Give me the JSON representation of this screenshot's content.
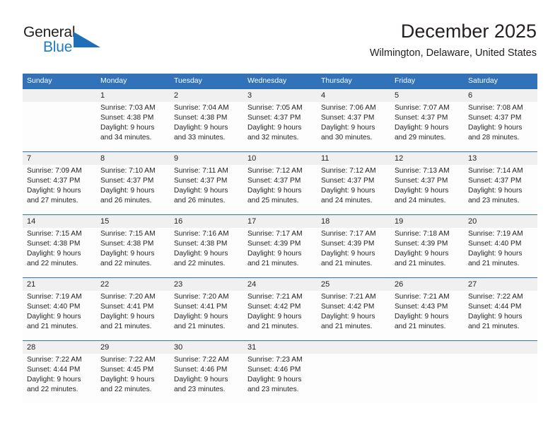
{
  "logo": {
    "word_one": "General",
    "word_two": "Blue",
    "triangle_color": "#1f6fb8",
    "blue_text_color": "#1f7bc1",
    "icon": "general-blue-logo"
  },
  "header": {
    "title": "December 2025",
    "location": "Wilmington, Delaware, United States"
  },
  "theme": {
    "header_bar": "#3172b9",
    "row_stripe": "#f0f0f0",
    "cell_background": "#fdfdfd",
    "text": "#231f20",
    "divider": "#3172b9"
  },
  "weekdays": [
    "Sunday",
    "Monday",
    "Tuesday",
    "Wednesday",
    "Thursday",
    "Friday",
    "Saturday"
  ],
  "weeks": [
    {
      "daynums": [
        "",
        "1",
        "2",
        "3",
        "4",
        "5",
        "6"
      ],
      "cells": [
        {
          "empty": true,
          "sunrise": "",
          "sunset": "",
          "daylight_line1": "",
          "daylight_line2": ""
        },
        {
          "empty": false,
          "sunrise": "Sunrise: 7:03 AM",
          "sunset": "Sunset: 4:38 PM",
          "daylight_line1": "Daylight: 9 hours",
          "daylight_line2": "and 34 minutes."
        },
        {
          "empty": false,
          "sunrise": "Sunrise: 7:04 AM",
          "sunset": "Sunset: 4:38 PM",
          "daylight_line1": "Daylight: 9 hours",
          "daylight_line2": "and 33 minutes."
        },
        {
          "empty": false,
          "sunrise": "Sunrise: 7:05 AM",
          "sunset": "Sunset: 4:37 PM",
          "daylight_line1": "Daylight: 9 hours",
          "daylight_line2": "and 32 minutes."
        },
        {
          "empty": false,
          "sunrise": "Sunrise: 7:06 AM",
          "sunset": "Sunset: 4:37 PM",
          "daylight_line1": "Daylight: 9 hours",
          "daylight_line2": "and 30 minutes."
        },
        {
          "empty": false,
          "sunrise": "Sunrise: 7:07 AM",
          "sunset": "Sunset: 4:37 PM",
          "daylight_line1": "Daylight: 9 hours",
          "daylight_line2": "and 29 minutes."
        },
        {
          "empty": false,
          "sunrise": "Sunrise: 7:08 AM",
          "sunset": "Sunset: 4:37 PM",
          "daylight_line1": "Daylight: 9 hours",
          "daylight_line2": "and 28 minutes."
        }
      ]
    },
    {
      "daynums": [
        "7",
        "8",
        "9",
        "10",
        "11",
        "12",
        "13"
      ],
      "cells": [
        {
          "empty": false,
          "sunrise": "Sunrise: 7:09 AM",
          "sunset": "Sunset: 4:37 PM",
          "daylight_line1": "Daylight: 9 hours",
          "daylight_line2": "and 27 minutes."
        },
        {
          "empty": false,
          "sunrise": "Sunrise: 7:10 AM",
          "sunset": "Sunset: 4:37 PM",
          "daylight_line1": "Daylight: 9 hours",
          "daylight_line2": "and 26 minutes."
        },
        {
          "empty": false,
          "sunrise": "Sunrise: 7:11 AM",
          "sunset": "Sunset: 4:37 PM",
          "daylight_line1": "Daylight: 9 hours",
          "daylight_line2": "and 26 minutes."
        },
        {
          "empty": false,
          "sunrise": "Sunrise: 7:12 AM",
          "sunset": "Sunset: 4:37 PM",
          "daylight_line1": "Daylight: 9 hours",
          "daylight_line2": "and 25 minutes."
        },
        {
          "empty": false,
          "sunrise": "Sunrise: 7:12 AM",
          "sunset": "Sunset: 4:37 PM",
          "daylight_line1": "Daylight: 9 hours",
          "daylight_line2": "and 24 minutes."
        },
        {
          "empty": false,
          "sunrise": "Sunrise: 7:13 AM",
          "sunset": "Sunset: 4:37 PM",
          "daylight_line1": "Daylight: 9 hours",
          "daylight_line2": "and 24 minutes."
        },
        {
          "empty": false,
          "sunrise": "Sunrise: 7:14 AM",
          "sunset": "Sunset: 4:37 PM",
          "daylight_line1": "Daylight: 9 hours",
          "daylight_line2": "and 23 minutes."
        }
      ]
    },
    {
      "daynums": [
        "14",
        "15",
        "16",
        "17",
        "18",
        "19",
        "20"
      ],
      "cells": [
        {
          "empty": false,
          "sunrise": "Sunrise: 7:15 AM",
          "sunset": "Sunset: 4:38 PM",
          "daylight_line1": "Daylight: 9 hours",
          "daylight_line2": "and 22 minutes."
        },
        {
          "empty": false,
          "sunrise": "Sunrise: 7:15 AM",
          "sunset": "Sunset: 4:38 PM",
          "daylight_line1": "Daylight: 9 hours",
          "daylight_line2": "and 22 minutes."
        },
        {
          "empty": false,
          "sunrise": "Sunrise: 7:16 AM",
          "sunset": "Sunset: 4:38 PM",
          "daylight_line1": "Daylight: 9 hours",
          "daylight_line2": "and 22 minutes."
        },
        {
          "empty": false,
          "sunrise": "Sunrise: 7:17 AM",
          "sunset": "Sunset: 4:39 PM",
          "daylight_line1": "Daylight: 9 hours",
          "daylight_line2": "and 21 minutes."
        },
        {
          "empty": false,
          "sunrise": "Sunrise: 7:17 AM",
          "sunset": "Sunset: 4:39 PM",
          "daylight_line1": "Daylight: 9 hours",
          "daylight_line2": "and 21 minutes."
        },
        {
          "empty": false,
          "sunrise": "Sunrise: 7:18 AM",
          "sunset": "Sunset: 4:39 PM",
          "daylight_line1": "Daylight: 9 hours",
          "daylight_line2": "and 21 minutes."
        },
        {
          "empty": false,
          "sunrise": "Sunrise: 7:19 AM",
          "sunset": "Sunset: 4:40 PM",
          "daylight_line1": "Daylight: 9 hours",
          "daylight_line2": "and 21 minutes."
        }
      ]
    },
    {
      "daynums": [
        "21",
        "22",
        "23",
        "24",
        "25",
        "26",
        "27"
      ],
      "cells": [
        {
          "empty": false,
          "sunrise": "Sunrise: 7:19 AM",
          "sunset": "Sunset: 4:40 PM",
          "daylight_line1": "Daylight: 9 hours",
          "daylight_line2": "and 21 minutes."
        },
        {
          "empty": false,
          "sunrise": "Sunrise: 7:20 AM",
          "sunset": "Sunset: 4:41 PM",
          "daylight_line1": "Daylight: 9 hours",
          "daylight_line2": "and 21 minutes."
        },
        {
          "empty": false,
          "sunrise": "Sunrise: 7:20 AM",
          "sunset": "Sunset: 4:41 PM",
          "daylight_line1": "Daylight: 9 hours",
          "daylight_line2": "and 21 minutes."
        },
        {
          "empty": false,
          "sunrise": "Sunrise: 7:21 AM",
          "sunset": "Sunset: 4:42 PM",
          "daylight_line1": "Daylight: 9 hours",
          "daylight_line2": "and 21 minutes."
        },
        {
          "empty": false,
          "sunrise": "Sunrise: 7:21 AM",
          "sunset": "Sunset: 4:42 PM",
          "daylight_line1": "Daylight: 9 hours",
          "daylight_line2": "and 21 minutes."
        },
        {
          "empty": false,
          "sunrise": "Sunrise: 7:21 AM",
          "sunset": "Sunset: 4:43 PM",
          "daylight_line1": "Daylight: 9 hours",
          "daylight_line2": "and 21 minutes."
        },
        {
          "empty": false,
          "sunrise": "Sunrise: 7:22 AM",
          "sunset": "Sunset: 4:44 PM",
          "daylight_line1": "Daylight: 9 hours",
          "daylight_line2": "and 21 minutes."
        }
      ]
    },
    {
      "daynums": [
        "28",
        "29",
        "30",
        "31",
        "",
        "",
        ""
      ],
      "cells": [
        {
          "empty": false,
          "sunrise": "Sunrise: 7:22 AM",
          "sunset": "Sunset: 4:44 PM",
          "daylight_line1": "Daylight: 9 hours",
          "daylight_line2": "and 22 minutes."
        },
        {
          "empty": false,
          "sunrise": "Sunrise: 7:22 AM",
          "sunset": "Sunset: 4:45 PM",
          "daylight_line1": "Daylight: 9 hours",
          "daylight_line2": "and 22 minutes."
        },
        {
          "empty": false,
          "sunrise": "Sunrise: 7:22 AM",
          "sunset": "Sunset: 4:46 PM",
          "daylight_line1": "Daylight: 9 hours",
          "daylight_line2": "and 23 minutes."
        },
        {
          "empty": false,
          "sunrise": "Sunrise: 7:23 AM",
          "sunset": "Sunset: 4:46 PM",
          "daylight_line1": "Daylight: 9 hours",
          "daylight_line2": "and 23 minutes."
        },
        {
          "empty": true,
          "sunrise": "",
          "sunset": "",
          "daylight_line1": "",
          "daylight_line2": ""
        },
        {
          "empty": true,
          "sunrise": "",
          "sunset": "",
          "daylight_line1": "",
          "daylight_line2": ""
        },
        {
          "empty": true,
          "sunrise": "",
          "sunset": "",
          "daylight_line1": "",
          "daylight_line2": ""
        }
      ]
    }
  ]
}
